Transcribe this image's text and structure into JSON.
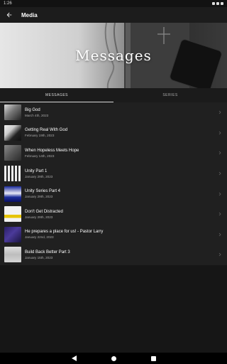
{
  "status": {
    "time": "1:26"
  },
  "app_bar": {
    "title": "Media"
  },
  "hero": {
    "title": "Messages"
  },
  "tabs": [
    {
      "label": "MESSAGES",
      "active": true
    },
    {
      "label": "SERIES",
      "active": false
    }
  ],
  "messages": [
    {
      "title": "Big God",
      "date": "March 4th, 2023"
    },
    {
      "title": "Getting Real With God",
      "date": "February 19th, 2023"
    },
    {
      "title": "When Hopeless Meets Hope",
      "date": "February 14th, 2023"
    },
    {
      "title": "Unity Part 1",
      "date": "January 29th, 2023"
    },
    {
      "title": "Unity Series Part 4",
      "date": "January 29th, 2023"
    },
    {
      "title": "Don't Get Distracted",
      "date": "January 29th, 2023"
    },
    {
      "title": "He prepares a place for us! - Pastor Larry",
      "date": "January 22nd, 2023"
    },
    {
      "title": "Build Back Better Part 3",
      "date": "January 15th, 2023"
    }
  ],
  "colors": {
    "background": "#161616",
    "list": "#202020",
    "app_bar": "#1c1c1c"
  },
  "icons": [
    "back-arrow-icon",
    "chevron-right-icon",
    "nav-back-icon",
    "nav-home-icon",
    "nav-recents-icon"
  ]
}
